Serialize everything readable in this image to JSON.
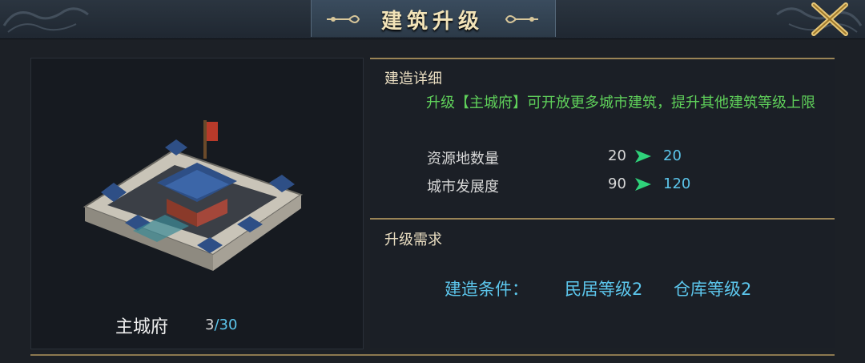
{
  "header": {
    "title": "建筑升级"
  },
  "building": {
    "name": "主城府",
    "level_current": "3",
    "level_sep": "/",
    "level_max": "30"
  },
  "details": {
    "title": "建造详细",
    "description": "升级【主城府】可开放更多城市建筑，提升其他建筑等级上限",
    "stats": [
      {
        "label": "资源地数量",
        "from": "20",
        "to": "20"
      },
      {
        "label": "城市发展度",
        "from": "90",
        "to": "120"
      }
    ]
  },
  "requirements": {
    "title": "升级需求",
    "condition_label": "建造条件：",
    "conditions": [
      "民居等级2",
      "仓库等级2"
    ]
  },
  "colors": {
    "accent_gold": "#9a8456",
    "value_blue": "#5cc6ec",
    "desc_green": "#5fd05a",
    "arrow_green": "#2fd27a"
  },
  "icons": [
    "close-icon",
    "building-main-city-image",
    "arrow-right-icon"
  ]
}
